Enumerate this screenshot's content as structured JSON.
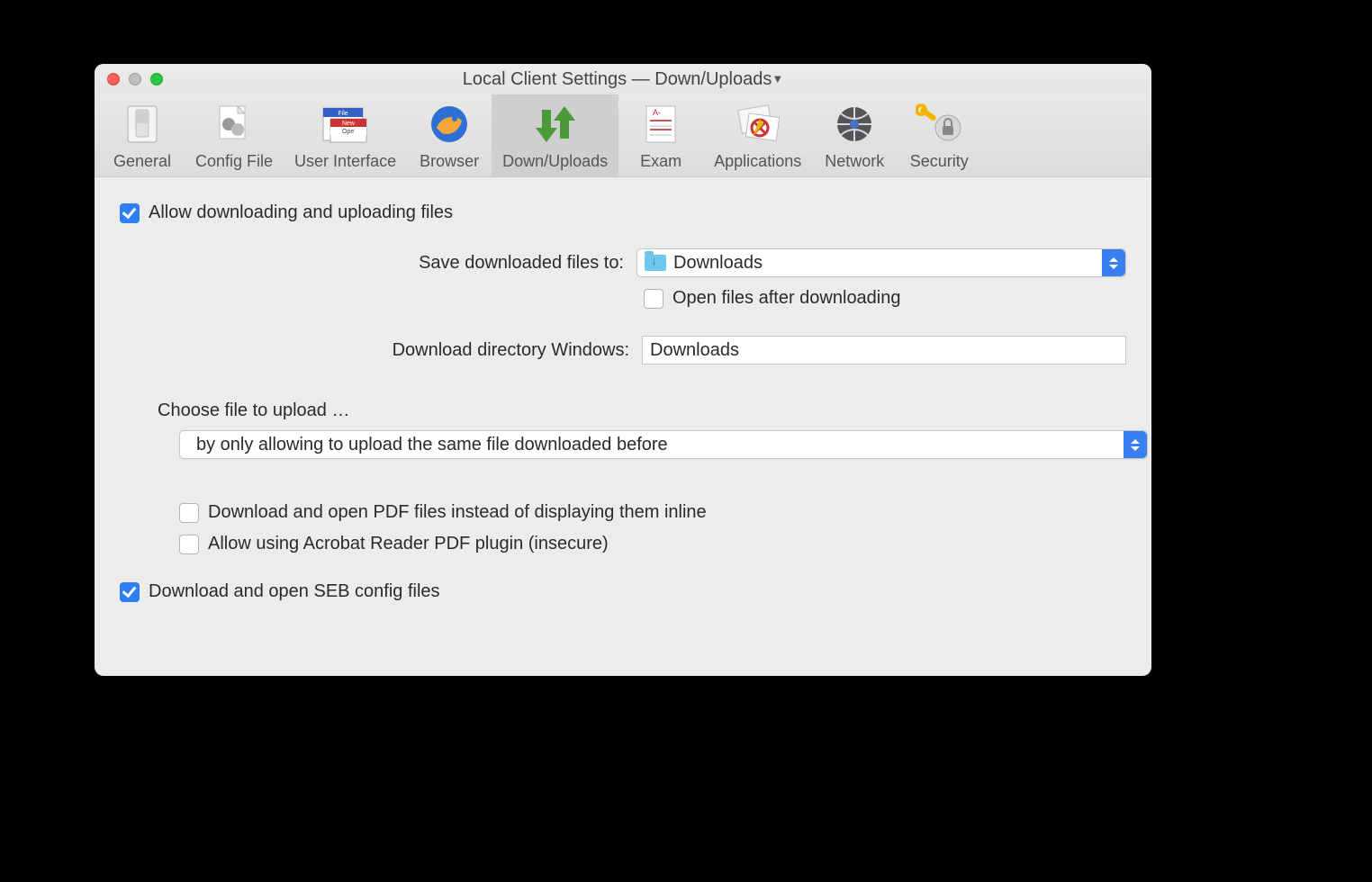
{
  "window": {
    "title_main": "Local Client Settings",
    "title_sep": "  —  ",
    "title_section": "Down/Uploads"
  },
  "toolbar": {
    "items": [
      {
        "id": "general",
        "label": "General"
      },
      {
        "id": "config",
        "label": "Config File"
      },
      {
        "id": "ui",
        "label": "User Interface"
      },
      {
        "id": "browser",
        "label": "Browser"
      },
      {
        "id": "downuploads",
        "label": "Down/Uploads",
        "active": true
      },
      {
        "id": "exam",
        "label": "Exam"
      },
      {
        "id": "applications",
        "label": "Applications"
      },
      {
        "id": "network",
        "label": "Network"
      },
      {
        "id": "security",
        "label": "Security"
      }
    ]
  },
  "main": {
    "allow_label": "Allow downloading and uploading files",
    "save_to_label": "Save downloaded files to:",
    "save_to_value": "Downloads",
    "open_after_label": "Open files after downloading",
    "win_dir_label": "Download directory Windows:",
    "win_dir_value": "Downloads",
    "choose_label": "Choose file to upload …",
    "choose_value": "by only allowing to upload the same file downloaded before",
    "pdf_inline_label": "Download and open PDF files instead of displaying them inline",
    "acrobat_label": "Allow using Acrobat Reader PDF plugin (insecure)",
    "seb_config_label": "Download and open SEB config files"
  }
}
